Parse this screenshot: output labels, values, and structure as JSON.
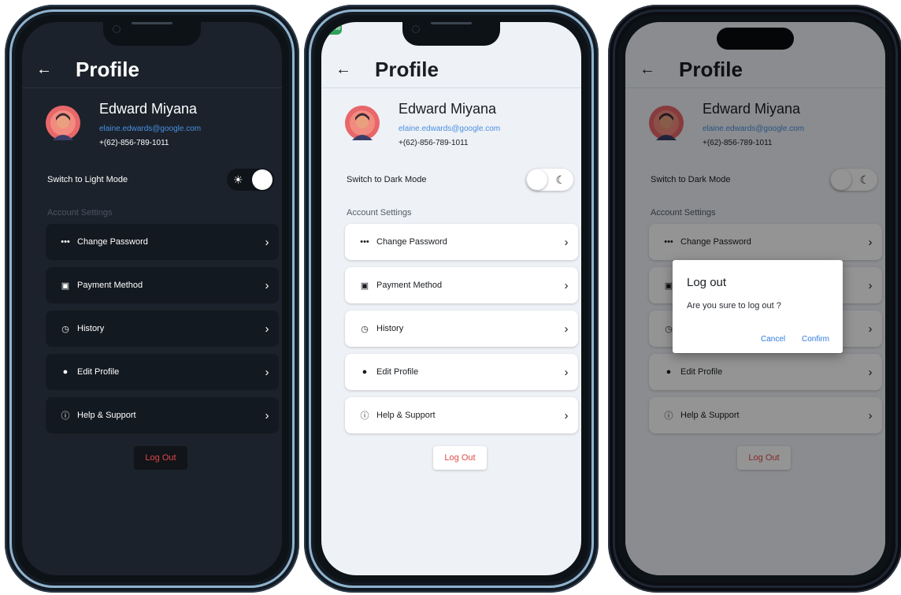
{
  "profile": {
    "title": "Profile",
    "name": "Edward Miyana",
    "email": "elaine.edwards@google.com",
    "phone": "+(62)-856-789-1011"
  },
  "screens": [
    {
      "theme": "dark",
      "mode_label": "Switch to Light Mode",
      "toggle_on": true
    },
    {
      "theme": "light",
      "mode_label": "Switch to Dark Mode",
      "toggle_on": false,
      "debug_ribbon": "Profile"
    },
    {
      "theme": "light-with-dialog",
      "mode_label": "Switch to Dark Mode",
      "toggle_on": false
    }
  ],
  "section_label": "Account Settings",
  "menu": [
    {
      "label": "Change Password",
      "icon": "password-dots-icon"
    },
    {
      "label": "Payment Method",
      "icon": "money-icon"
    },
    {
      "label": "History",
      "icon": "history-icon"
    },
    {
      "label": "Edit Profile",
      "icon": "person-icon"
    },
    {
      "label": "Help & Support",
      "icon": "help-icon"
    }
  ],
  "logout_label": "Log Out",
  "dialog": {
    "title": "Log out",
    "message": "Are you sure to log out ?",
    "cancel": "Cancel",
    "confirm": "Confirm"
  },
  "colors": {
    "dark_bg": "#1b222b",
    "light_bg": "#eef1f6",
    "email": "#4a90e2",
    "logout": "#e04848",
    "dialog_action": "#2f7be0"
  }
}
